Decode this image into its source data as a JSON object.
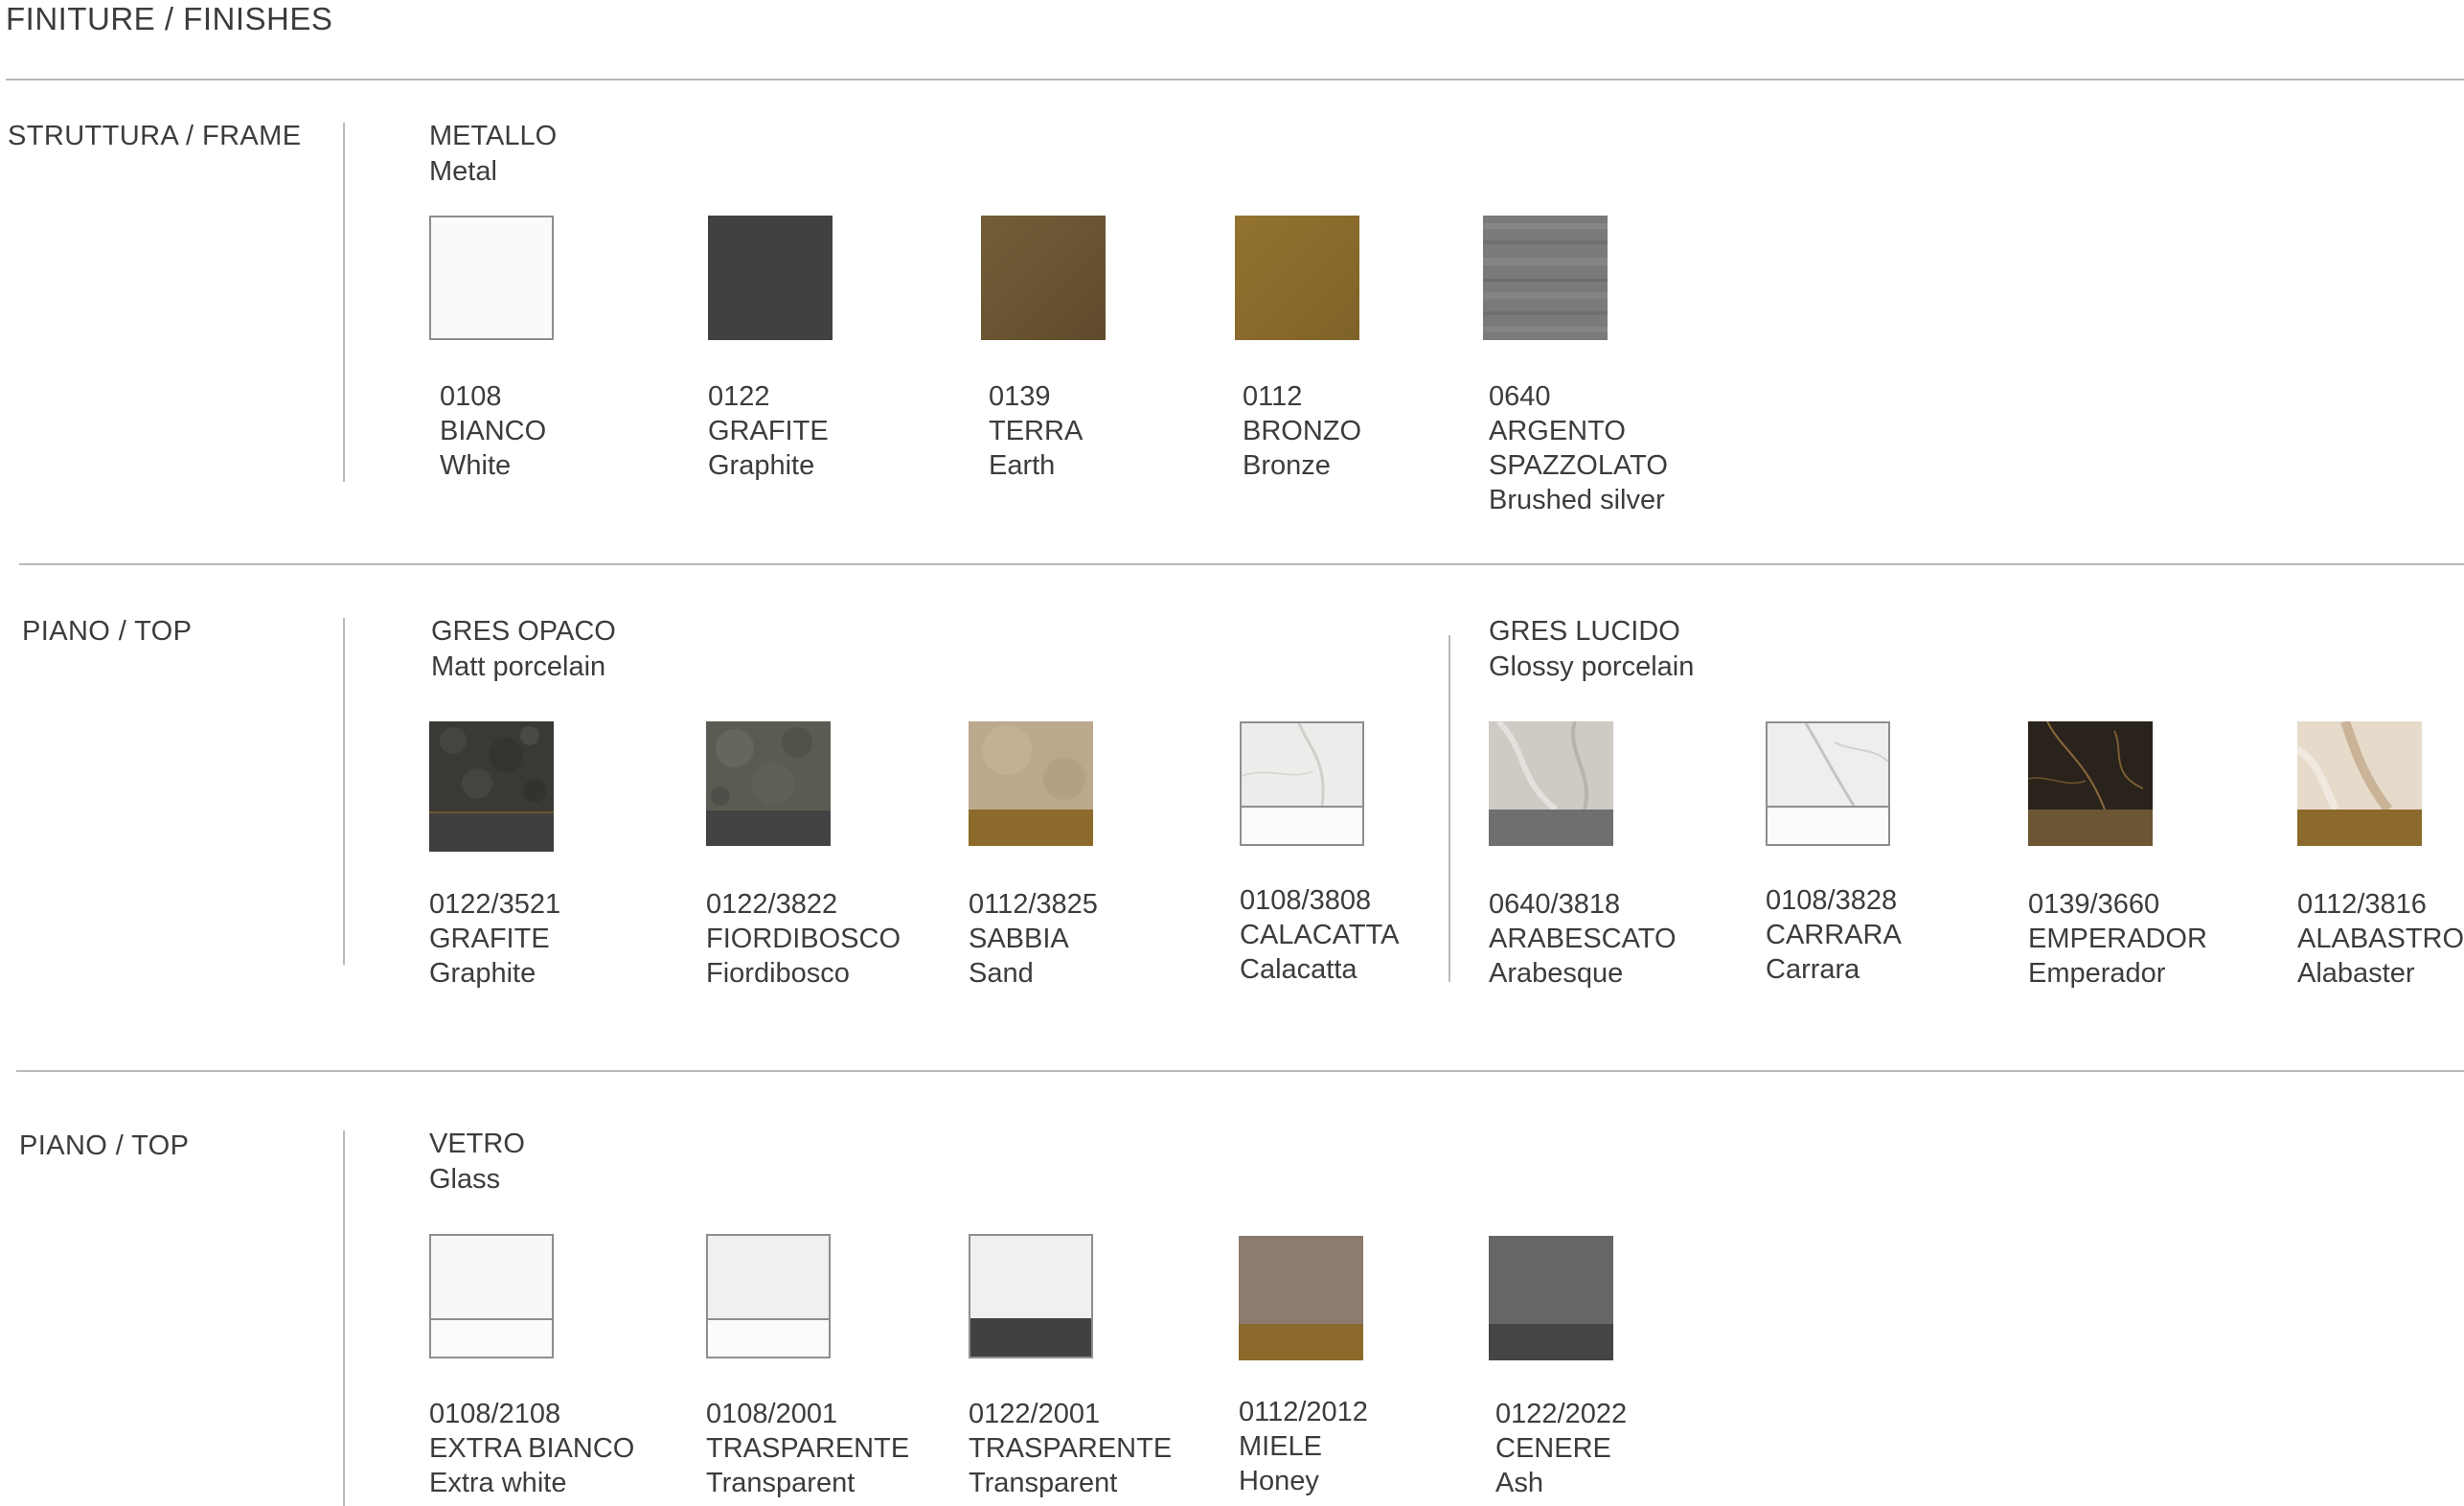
{
  "title": "FINITURE / FINISHES",
  "sections": {
    "frame": {
      "label": "STRUTTURA / FRAME",
      "groups": {
        "metal": {
          "name_it": "METALLO",
          "name_en": "Metal",
          "items": [
            {
              "code": "0108",
              "name_it": "BIANCO",
              "name_en": "White",
              "top": "#fafafa"
            },
            {
              "code": "0122",
              "name_it": "GRAFITE",
              "name_en": "Graphite",
              "top": "#424141"
            },
            {
              "code": "0139",
              "name_it": "TERRA",
              "name_en": "Earth",
              "top": "#6b5533"
            },
            {
              "code": "0112",
              "name_it": "BRONZO",
              "name_en": "Bronze",
              "top": "#8b6b2e"
            },
            {
              "code": "0640",
              "name_it": "ARGENTO",
              "name_it_2": "SPAZZOLATO",
              "name_en": "Brushed silver",
              "top": "#7c7c7c"
            }
          ]
        }
      }
    },
    "top_ceramic": {
      "label": "PIANO / TOP",
      "groups": {
        "matt": {
          "name_it": "GRES OPACO",
          "name_en": "Matt porcelain",
          "items": [
            {
              "code": "0122/3521",
              "name_it": "GRAFITE",
              "name_en": "Graphite",
              "top": "#3d3b37",
              "bottom": "#403f3e"
            },
            {
              "code": "0122/3822",
              "name_it": "FIORDIBOSCO",
              "name_en": "Fiordibosco",
              "top": "#5e5d55",
              "bottom": "#444343"
            },
            {
              "code": "0112/3825",
              "name_it": "SABBIA",
              "name_en": "Sand",
              "top": "#bca88c",
              "bottom": "#8c6a2b"
            },
            {
              "code": "0108/3808",
              "name_it": "CALACATTA",
              "name_en": "Calacatta",
              "top": "#ececea",
              "bottom": "#fbfbfb"
            }
          ]
        },
        "glossy": {
          "name_it": "GRES LUCIDO",
          "name_en": "Glossy porcelain",
          "items": [
            {
              "code": "0640/3818",
              "name_it": "ARABESCATO",
              "name_en": "Arabesque",
              "top": "#cfcbc4",
              "bottom": "#6f6f6f"
            },
            {
              "code": "0108/3828",
              "name_it": "CARRARA",
              "name_en": "Carrara",
              "top": "#eeeeee",
              "bottom": "#fbfbfb"
            },
            {
              "code": "0139/3660",
              "name_it": "EMPERADOR",
              "name_en": "Emperador",
              "top": "#2a231c",
              "bottom": "#6b5533"
            },
            {
              "code": "0112/3816",
              "name_it": "ALABASTRO",
              "name_en": "Alabaster",
              "top": "#e6dacb",
              "bottom": "#8c6a2b"
            }
          ]
        }
      }
    },
    "top_glass": {
      "label": "PIANO / TOP",
      "groups": {
        "glass": {
          "name_it": "VETRO",
          "name_en": "Glass",
          "items": [
            {
              "code": "0108/2108",
              "name_it": "EXTRA BIANCO",
              "name_en": "Extra white",
              "top": "#f8f8f8",
              "bottom": "#fbfbfb"
            },
            {
              "code": "0108/2001",
              "name_it": "TRASPARENTE",
              "name_en": "Transparent",
              "top": "#eef1ee",
              "bottom": "#fbfbfb"
            },
            {
              "code": "0122/2001",
              "name_it": "TRASPARENTE",
              "name_en": "Transparent",
              "top": "#eef1ee",
              "bottom": "#424141"
            },
            {
              "code": "0112/2012",
              "name_it": "MIELE",
              "name_en": "Honey",
              "top": "#8c7b6f",
              "bottom": "#8c6a2b"
            },
            {
              "code": "0122/2022",
              "name_it": "CENERE",
              "name_en": "Ash",
              "top": "#666666",
              "bottom": "#454545"
            }
          ]
        }
      }
    }
  }
}
